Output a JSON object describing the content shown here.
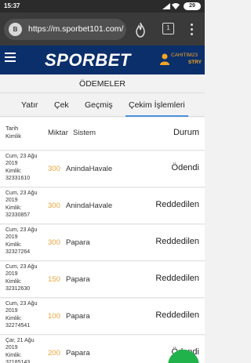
{
  "status_bar": {
    "time": "15:37",
    "battery": "29"
  },
  "browser": {
    "site_icon_label": "B",
    "url": "https://m.sporbet101.com/",
    "tab_count": "1"
  },
  "site": {
    "logo_text": "SPORBET",
    "username": "CAHITIM23",
    "currency": "STRY",
    "brand_color": "#0b2f6b",
    "accent_color": "#f5a623"
  },
  "page": {
    "title": "ÖDEMELER",
    "tabs": [
      {
        "label": "Yatır",
        "active": false
      },
      {
        "label": "Çek",
        "active": false
      },
      {
        "label": "Geçmiş",
        "active": false
      },
      {
        "label": "Çekim İşlemleri",
        "active": true
      }
    ]
  },
  "table": {
    "headers": {
      "date_line1": "Tarih",
      "date_line2": "Kimlik",
      "amount": "Miktar",
      "system": "Sistem",
      "status": "Durum"
    },
    "rows": [
      {
        "date_line1": "Cum, 23 Ağu",
        "date_line2": "2019",
        "id_label": "Kimlik:",
        "id": "32331610",
        "amount": "300",
        "system": "AnindaHavale",
        "status": "Ödendi"
      },
      {
        "date_line1": "Cum, 23 Ağu",
        "date_line2": "2019",
        "id_label": "Kimlik:",
        "id": "32330857",
        "amount": "300",
        "system": "AnindaHavale",
        "status": "Reddedilen"
      },
      {
        "date_line1": "Cum, 23 Ağu",
        "date_line2": "2019",
        "id_label": "Kimlik:",
        "id": "32327264",
        "amount": "300",
        "system": "Papara",
        "status": "Reddedilen"
      },
      {
        "date_line1": "Cum, 23 Ağu",
        "date_line2": "2019",
        "id_label": "Kimlik:",
        "id": "32312630",
        "amount": "150",
        "system": "Papara",
        "status": "Reddedilen"
      },
      {
        "date_line1": "Cum, 23 Ağu",
        "date_line2": "2019",
        "id_label": "Kimlik:",
        "id": "32274541",
        "amount": "100",
        "system": "Papara",
        "status": "Reddedilen"
      },
      {
        "date_line1": "Çar, 21 Ağu",
        "date_line2": "2019",
        "id_label": "Kimlik:",
        "id": "32185143",
        "amount": "200",
        "system": "Papara",
        "status": "Ödendi"
      }
    ]
  }
}
